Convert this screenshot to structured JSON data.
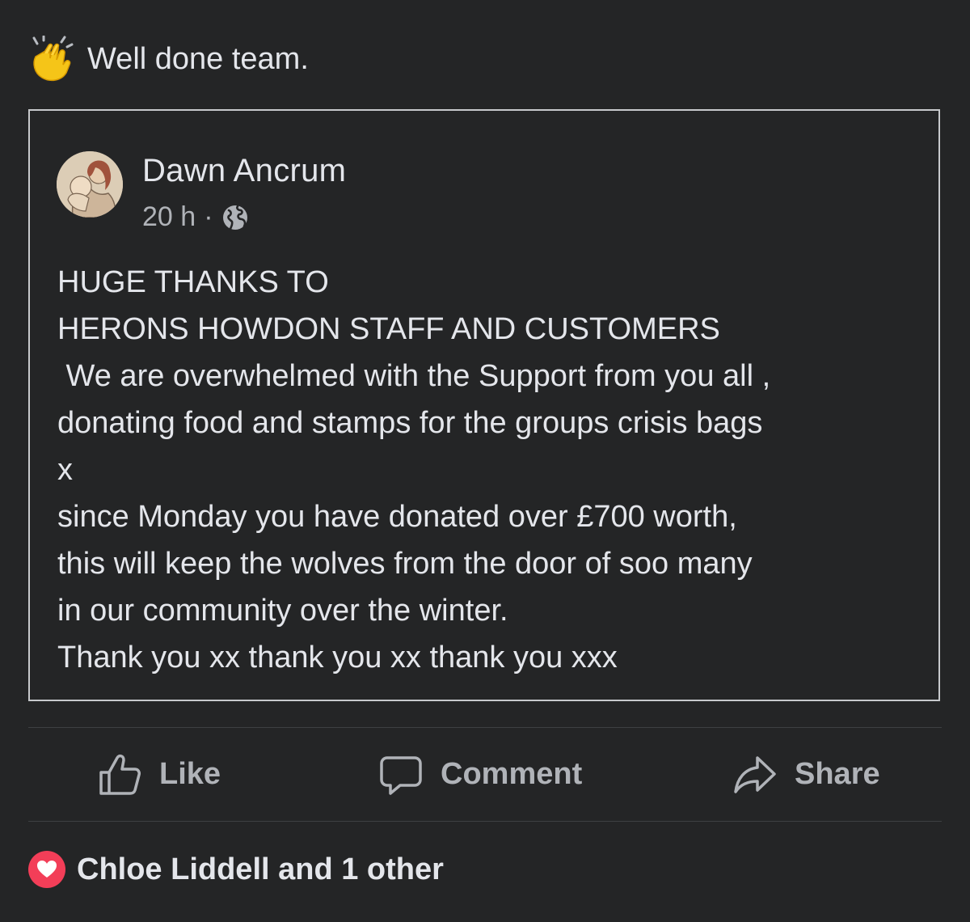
{
  "caption": {
    "emoji": "clapping-hands",
    "text": "Well done team."
  },
  "shared_post": {
    "author": "Dawn Ancrum",
    "time": "20 h",
    "separator": "·",
    "audience_icon": "globe-icon",
    "lines": [
      "HUGE THANKS TO",
      "HERONS HOWDON STAFF AND CUSTOMERS",
      " We are overwhelmed with the Support from you all ,",
      "donating food and stamps for the groups crisis bags",
      "x",
      "since Monday you have donated over £700 worth,",
      "this will keep the wolves from the door of soo many",
      "in our community over the winter.",
      "Thank you xx thank you xx thank you xxx"
    ]
  },
  "actions": {
    "like": "Like",
    "comment": "Comment",
    "share": "Share"
  },
  "reactions": {
    "icon": "heart-icon",
    "color": "#f33e58",
    "text": "Chloe Liddell and 1 other"
  },
  "colors": {
    "background": "#242526",
    "text": "#e4e6eb",
    "muted": "#b0b3b8",
    "border": "#c7c9cc"
  }
}
